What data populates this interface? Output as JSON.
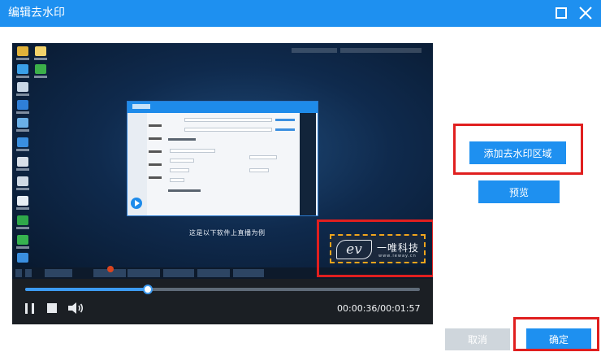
{
  "window": {
    "title": "编辑去水印",
    "accent": "#1e90f0",
    "highlight": "#e01f1f"
  },
  "titlebar": {
    "maximize_icon": "maximize-icon",
    "close_icon": "close-icon"
  },
  "video": {
    "subtitle": "这是以下软件上直播为例",
    "watermark": {
      "logo_text": "ev",
      "brand": "一唯科技",
      "url": "www.ieway.cn",
      "border_color": "#f0a51c"
    }
  },
  "controls": {
    "current_time": "00:00:36",
    "total_time": "00:01:57",
    "time_display": "00:00:36/00:01:57",
    "progress_fraction": 0.31,
    "pause_icon": "pause-icon",
    "stop_icon": "stop-icon",
    "volume_icon": "volume-icon"
  },
  "actions": {
    "add_watermark_area": "添加去水印区域",
    "preview": "预览",
    "cancel": "取消",
    "confirm": "确定"
  }
}
